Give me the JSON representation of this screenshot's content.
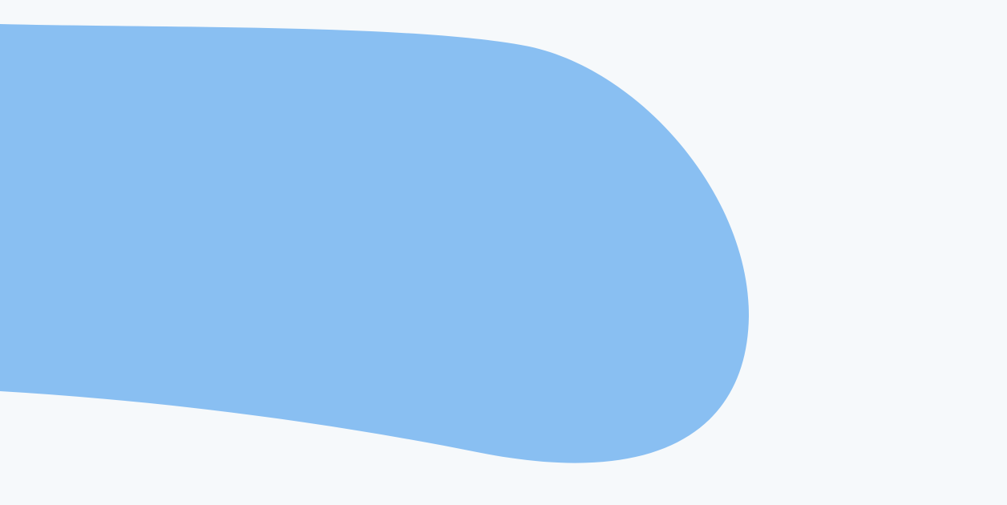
{
  "colors": {
    "background": "#F6F9FB",
    "blob": "#89BFF2"
  }
}
